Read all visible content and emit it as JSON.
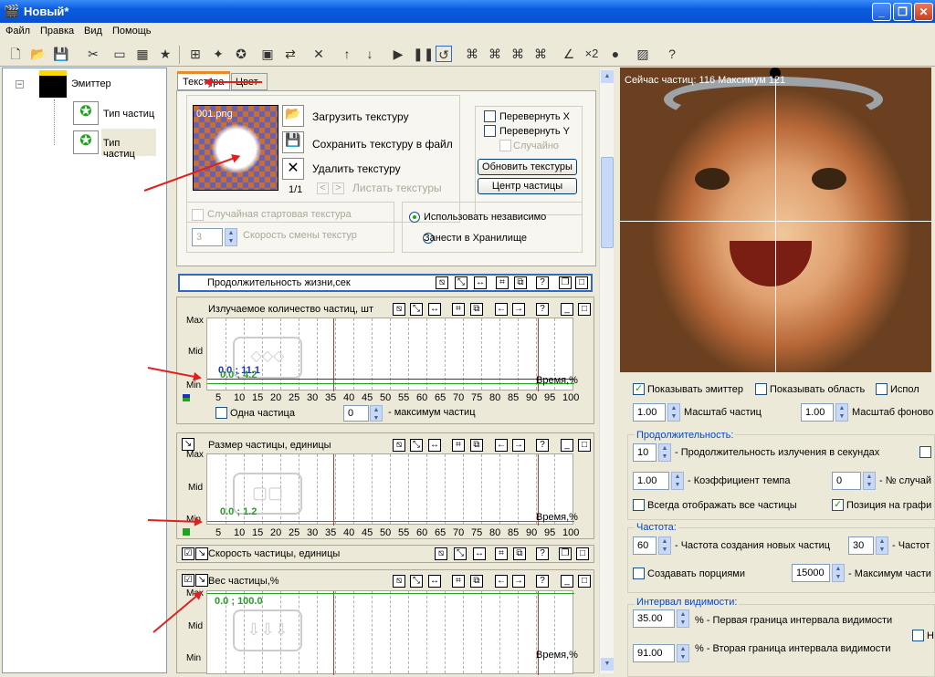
{
  "window": {
    "title": "Новый*",
    "min": "_",
    "max": "❐",
    "close": "✕"
  },
  "menu": [
    "Файл",
    "Правка",
    "Вид",
    "Помощь"
  ],
  "tree": {
    "emitter": "Эмиттер",
    "type1": "Тип частиц",
    "type2": "Тип частиц"
  },
  "tabs": {
    "texture": "Текстура",
    "color": "Цвет"
  },
  "texture": {
    "file": "001.png",
    "load": "Загрузить текстуру",
    "save": "Сохранить текстуру в файл",
    "delete": "Удалить текстуру",
    "counter": "1/1",
    "list": "Листать текстуры",
    "flipx": "Перевернуть X",
    "flipy": "Перевернуть Y",
    "random": "Случайно",
    "refresh": "Обновить текстуры",
    "center": "Центр частицы",
    "random_start": "Случайная стартовая текстура",
    "speed_value": "3",
    "speed_label": "Скорость смены текстур",
    "independent": "Использовать независимо",
    "storage": "Занести в Хранилище"
  },
  "graphs": {
    "life": "Продолжительность жизни,сек",
    "emit": {
      "title": "Излучаемое количество частиц, шт",
      "v1": "0.0 ; 11.1",
      "v2": "0.0 ; 4.2",
      "single": "Одна частица",
      "max_value": "0",
      "max_label": "- максимум частиц"
    },
    "size": {
      "title": "Размер частицы, единицы",
      "v1": "0.0 ; 1.2"
    },
    "speed": "Скорость частицы, единицы",
    "weight": {
      "title": "Вес частицы,%",
      "v1": "0.0 ; 100.0"
    },
    "ymax": "Max",
    "ymid": "Mid",
    "ymin": "Min",
    "time": "Время,%",
    "ticks": [
      "5",
      "10",
      "15",
      "20",
      "25",
      "30",
      "35",
      "40",
      "45",
      "50",
      "55",
      "60",
      "65",
      "70",
      "75",
      "80",
      "85",
      "90",
      "95",
      "100"
    ]
  },
  "preview": {
    "stats": "Сейчас частиц: 116   Максимум 121"
  },
  "props": {
    "show_emitter": "Показывать эмиттер",
    "show_area": "Показывать область",
    "use": "Испол",
    "scale_value": "1.00",
    "scale_label": "Масштаб частиц",
    "bgscale_value": "1.00",
    "bgscale_label": "Масштаб фоново",
    "duration_group": "Продолжительность:",
    "emit_sec_value": "10",
    "emit_sec_label": "- Продолжительность излучения в секундах",
    "tempo_value": "1.00",
    "tempo_label": "- Коэффициент темпа",
    "rand_value": "0",
    "rand_label": "- № случай",
    "always_show": "Всегда отображать все частицы",
    "graph_pos": "Позиция на графи",
    "freq_group": "Частота:",
    "freq_value": "60",
    "freq_label": "- Частота создания новых частиц",
    "freq2_value": "30",
    "freq2_label": "- Частот",
    "portions": "Создавать порциями",
    "max_value": "15000",
    "max_label": "- Максимум части",
    "vis_group": "Интервал видимости:",
    "vis1_value": "35.00",
    "vis1_label": "% - Первая граница интервала видимости",
    "vis2_value": "91.00",
    "vis2_label": "% - Вторая граница интервала видимости",
    "vis_n": "Н"
  }
}
